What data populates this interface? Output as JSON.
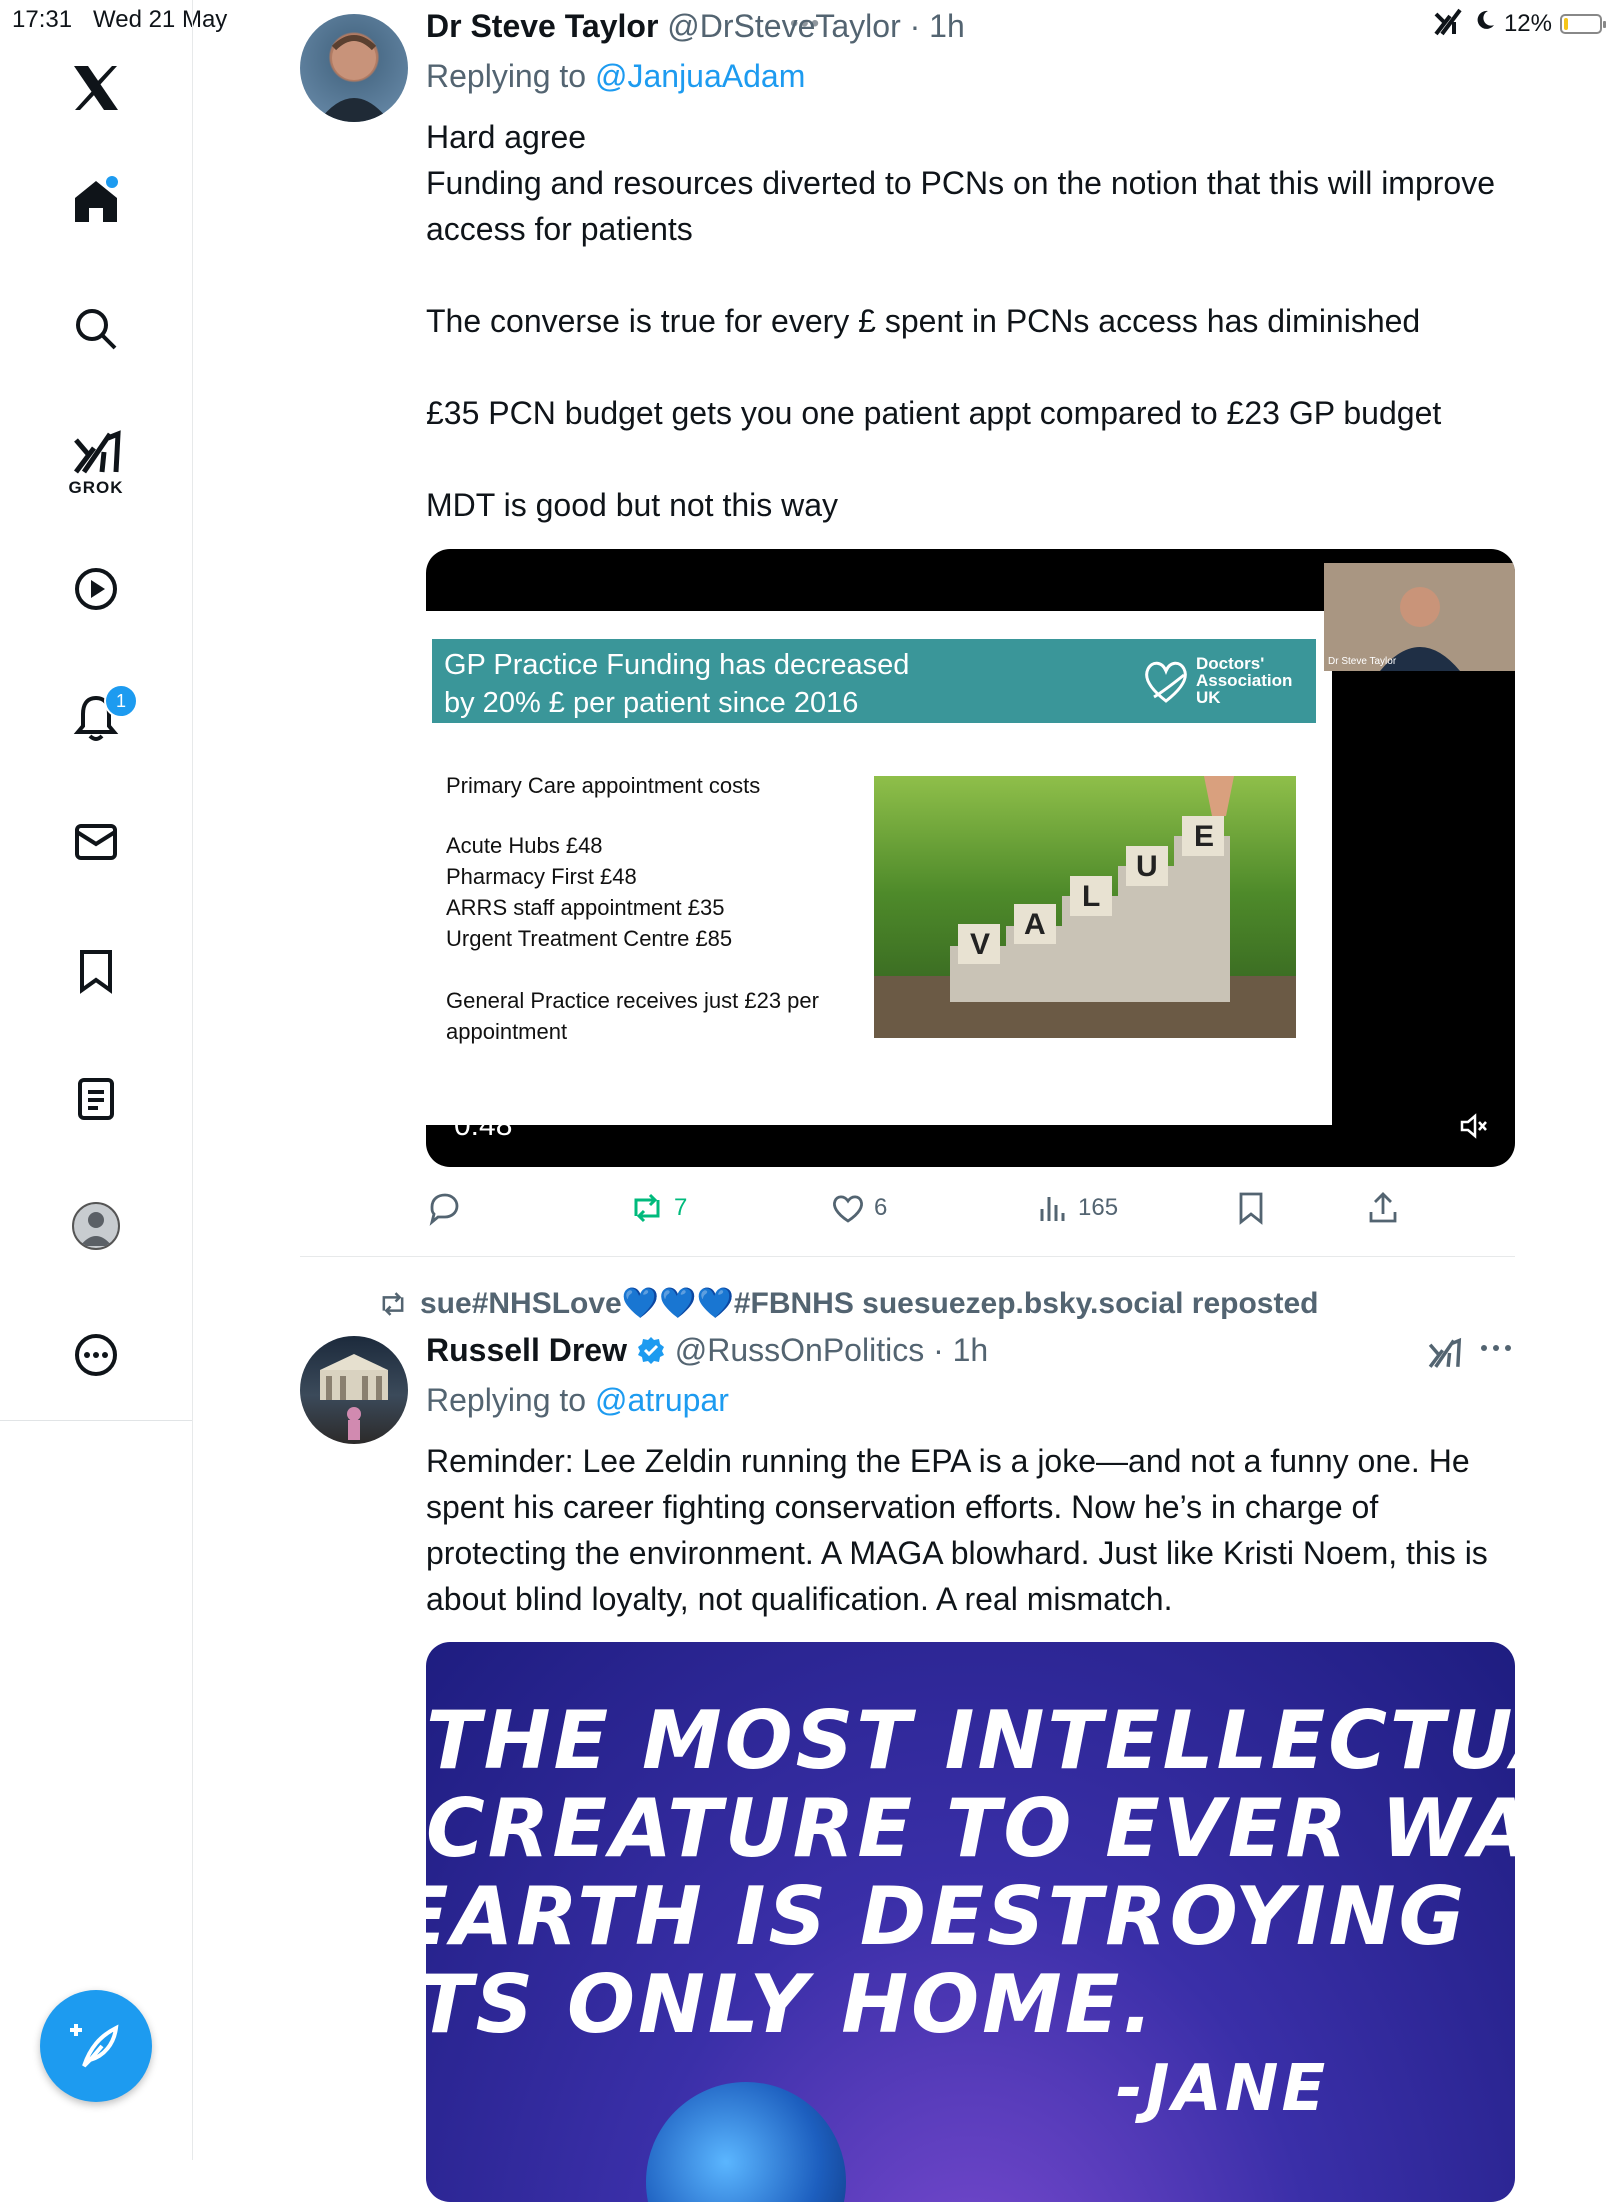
{
  "status_bar": {
    "time": "17:31",
    "date": "Wed 21 May",
    "battery": "12%",
    "battery_level": 0.12
  },
  "sidebar": {
    "grok_label": "GROK",
    "notifications_count": "1"
  },
  "tweet1": {
    "display_name": "Dr Steve Taylor",
    "handle": "@DrSteveTaylor",
    "time": "· 1h",
    "replying_prefix": "Replying to",
    "replying_handle": "@JanjuaAdam",
    "text": "Hard agree\nFunding and resources diverted to PCNs on the notion that this will improve access for patients\n\nThe converse is true for every £ spent in PCNs access has diminished\n\n£35 PCN budget gets you one patient appt compared to £23 GP budget\n\nMDT is good but not this way",
    "video": {
      "slide_title_line1": "GP Practice Funding has decreased",
      "slide_title_line2": "by 20% £ per patient since 2016",
      "logo_line1": "Doctors'",
      "logo_line2": "Association",
      "logo_line3": "UK",
      "heading": "Primary Care appointment costs",
      "items": [
        "Acute Hubs £48",
        "Pharmacy First £48",
        "ARRS staff appointment £35",
        "Urgent Treatment Centre £85"
      ],
      "footer_line1": "General Practice receives just £23 per",
      "footer_line2": "appointment",
      "coin_letters": [
        "V",
        "A",
        "L",
        "U",
        "E"
      ],
      "webcam_label": "Dr Steve Taylor",
      "duration": "0:48"
    },
    "actions": {
      "retweets": "7",
      "likes": "6",
      "views": "165"
    }
  },
  "tweet2": {
    "repost_by": "sue#NHSLove",
    "repost_hearts": "💙💙💙",
    "repost_suffix": "#FBNHS suesuezep.bsky.social reposted",
    "display_name": "Russell Drew",
    "handle": "@RussOnPolitics",
    "time": "· 1h",
    "replying_prefix": "Replying to",
    "replying_handle": "@atrupar",
    "text": "Reminder: Lee Zeldin running the EPA is a joke—and not a funny one. He spent his career fighting conservation efforts. Now he’s in charge of protecting the environment. A MAGA blowhard. Just like Kristi Noem, this is about blind loyalty, not qualification. A real mismatch.",
    "image_quote_lines": [
      "THE MOST INTELLECTUAL",
      "CREATURE TO EVER WALK",
      "EARTH IS DESTROYING",
      "ITS ONLY HOME."
    ],
    "image_author": "-JANE"
  }
}
